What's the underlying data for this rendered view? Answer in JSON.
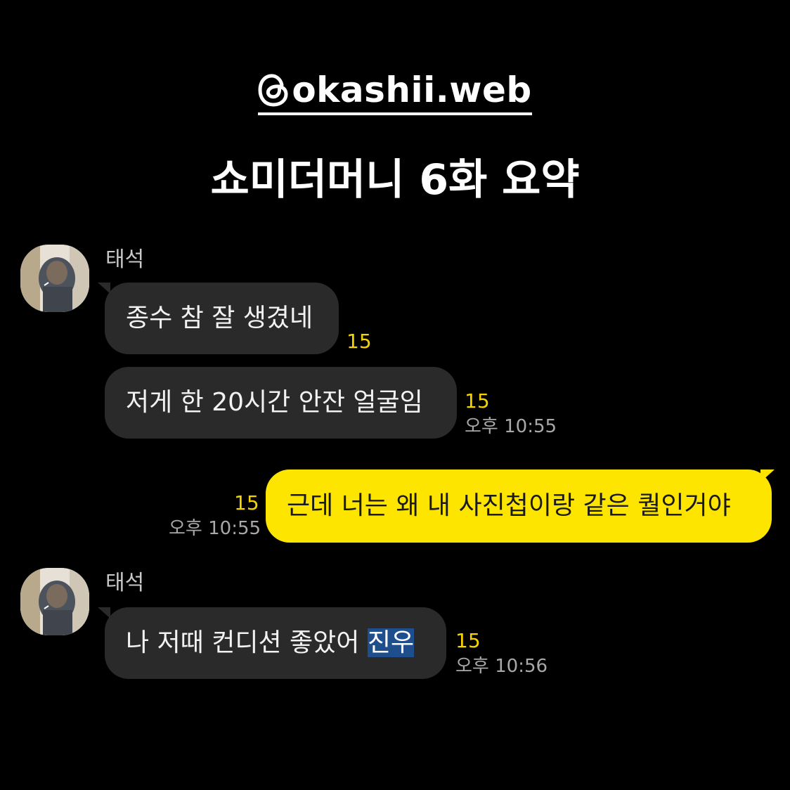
{
  "header": {
    "handle": "okashii.web",
    "title": "쇼미더머니 6화 요약"
  },
  "messages": [
    {
      "sender": "태석",
      "text": "종수 참 잘 생겼네",
      "unread": "15",
      "time": ""
    },
    {
      "sender": "",
      "text": "저게 한 20시간 안잔 얼굴임",
      "unread": "15",
      "time": "오후 10:55"
    },
    {
      "sender": "me",
      "text": "근데 너는 왜 내 사진첩이랑 같은 퀄인거야",
      "unread": "15",
      "time": "오후 10:55"
    },
    {
      "sender": "태석",
      "text_plain": "나 저때 컨디션 좋았어 ",
      "text_highlight": "진우",
      "unread": "15",
      "time": "오후 10:56"
    }
  ],
  "colors": {
    "background": "#000000",
    "incoming_bubble": "#2a2a2a",
    "outgoing_bubble": "#fde500",
    "unread": "#f5d300",
    "highlight": "#1f4e8c"
  },
  "icons": {
    "threads": "threads-icon",
    "avatar": "profile-photo"
  }
}
